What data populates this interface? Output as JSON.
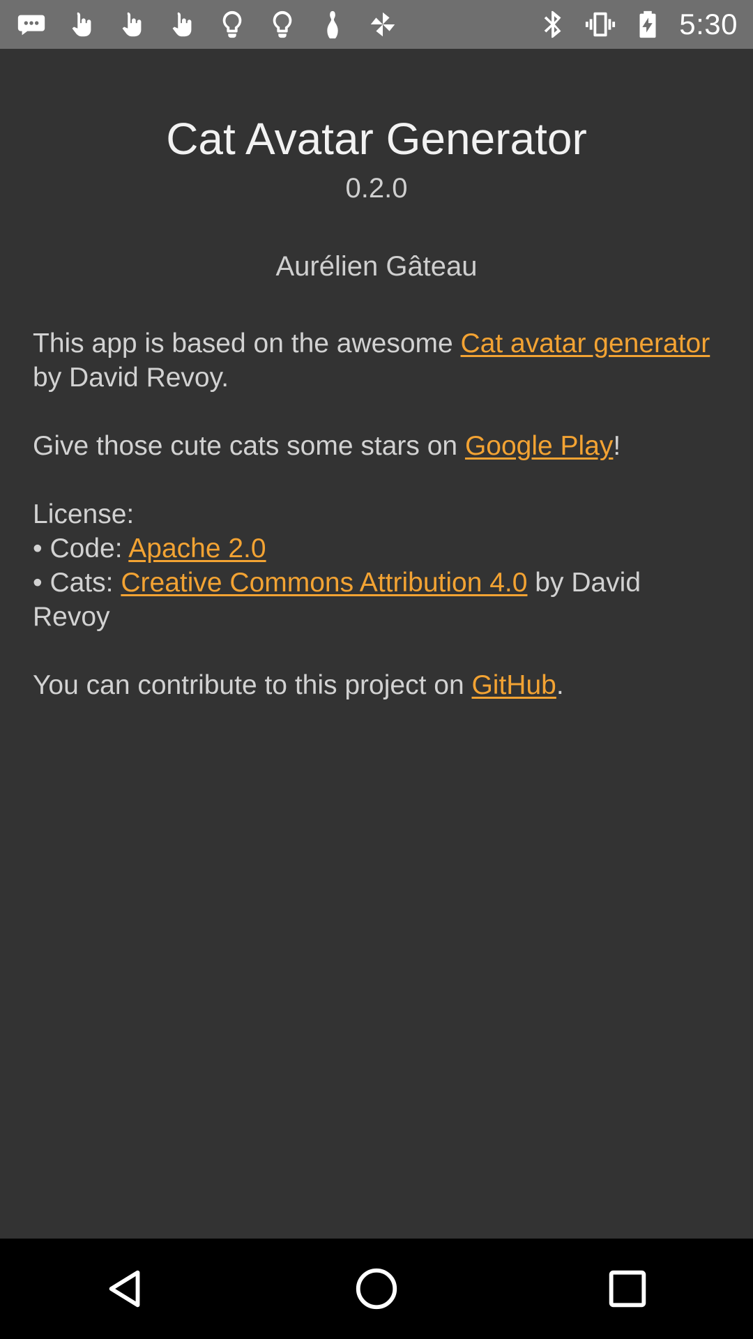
{
  "status_bar": {
    "time": "5:30",
    "left_icons": [
      "messaging-icon",
      "touch-icon",
      "touch-icon",
      "touch-icon",
      "lightbulb-icon",
      "lightbulb-icon",
      "bowling-pin-icon",
      "pinwheel-icon"
    ],
    "right_icons": [
      "bluetooth-icon",
      "vibrate-icon",
      "battery-charging-icon"
    ]
  },
  "about": {
    "title": "Cat Avatar Generator",
    "version": "0.2.0",
    "author": "Aurélien Gâteau",
    "p1_prefix": "This app is based on the awesome ",
    "p1_link": "Cat avatar generator",
    "p1_suffix": " by David Revoy.",
    "p2_prefix": "Give those cute cats some stars on ",
    "p2_link": "Google Play",
    "p2_suffix": "!",
    "license_heading": "License:",
    "code_prefix": "• Code: ",
    "code_link": "Apache 2.0",
    "cats_prefix": "• Cats: ",
    "cats_link": "Creative Commons Attribution 4.0",
    "cats_suffix": " by David Revoy",
    "p4_prefix": "You can contribute to this project on ",
    "p4_link": "GitHub",
    "p4_suffix": "."
  },
  "nav_bar": {
    "buttons": [
      "back-icon",
      "home-icon",
      "recents-icon"
    ]
  },
  "colors": {
    "background": "#333333",
    "status_bar": "#6f6f6f",
    "link": "#f3a333",
    "nav_bar": "#000000"
  }
}
